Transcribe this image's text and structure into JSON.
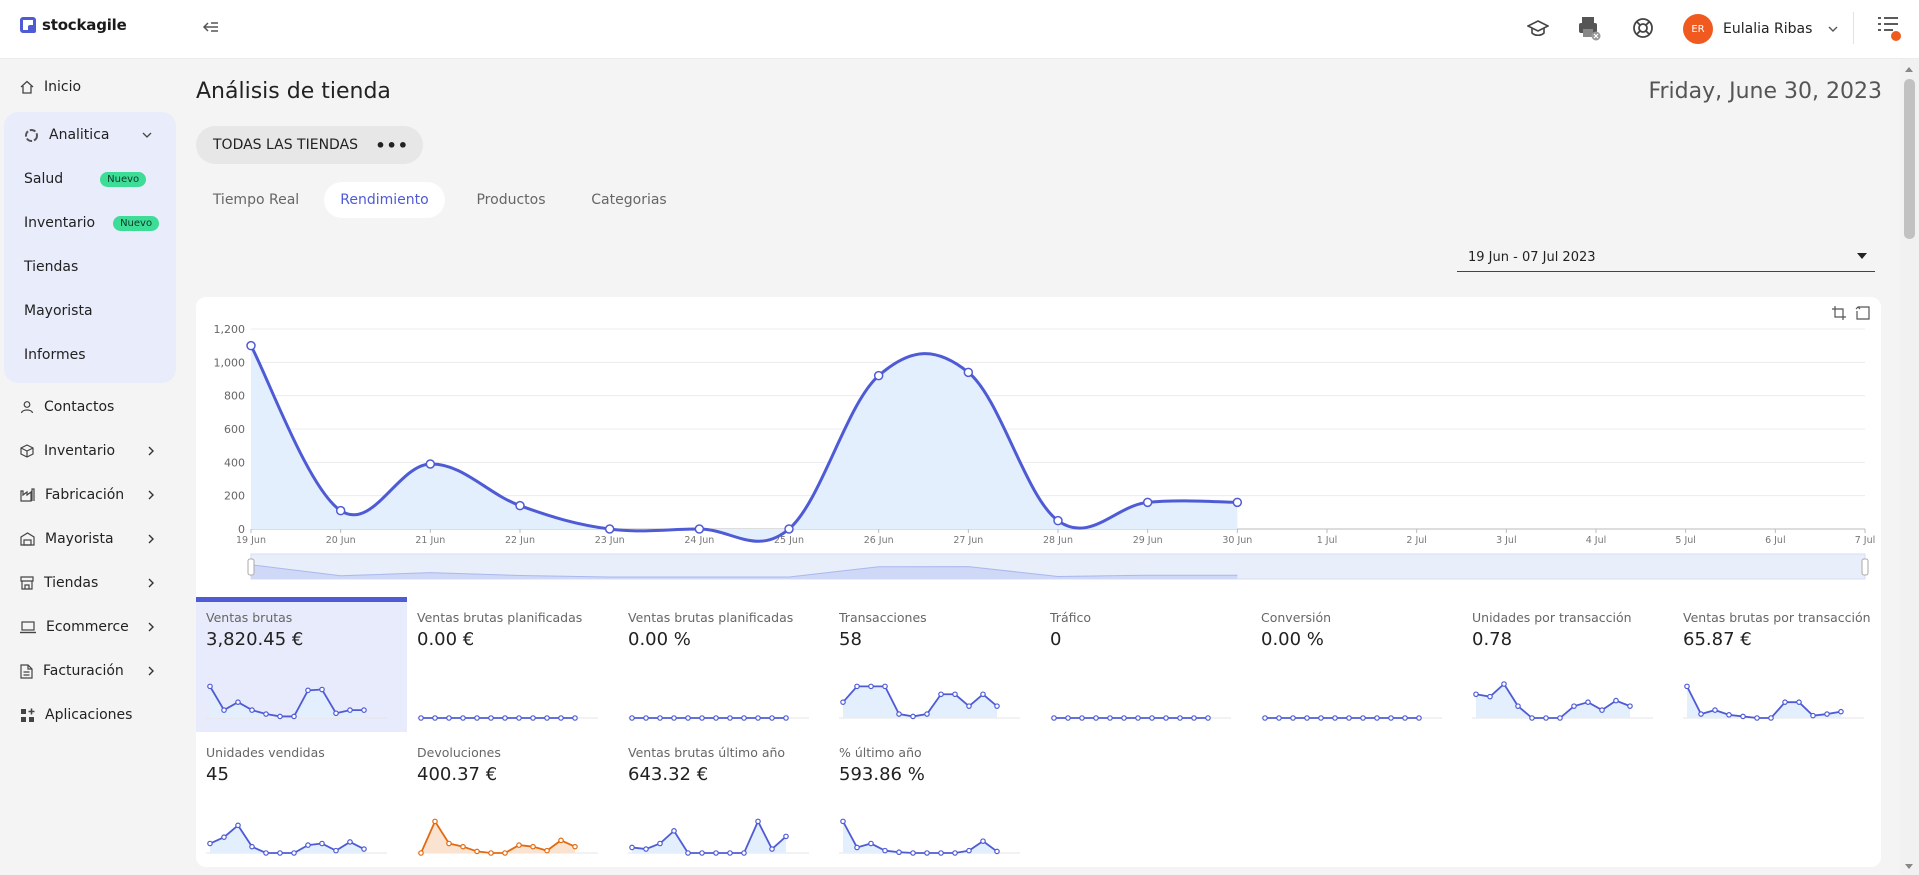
{
  "app": {
    "brand": "stockagile"
  },
  "header": {
    "user_initials": "ER",
    "user_name": "Eulalia Ribas",
    "icons": [
      "graduation-cap-icon",
      "printer-icon",
      "support-icon",
      "menu-list-icon"
    ]
  },
  "sidebar": {
    "home": "Inicio",
    "analytics": {
      "label": "Analitica",
      "items": [
        {
          "label": "Salud",
          "badge": "Nuevo"
        },
        {
          "label": "Inventario",
          "badge": "Nuevo"
        },
        {
          "label": "Tiendas",
          "badge": ""
        },
        {
          "label": "Mayorista",
          "badge": ""
        },
        {
          "label": "Informes",
          "badge": ""
        }
      ]
    },
    "items": [
      {
        "label": "Contactos",
        "icon": "user-icon"
      },
      {
        "label": "Inventario",
        "icon": "box-icon"
      },
      {
        "label": "Fabricación",
        "icon": "factory-icon"
      },
      {
        "label": "Mayorista",
        "icon": "warehouse-icon"
      },
      {
        "label": "Tiendas",
        "icon": "store-icon"
      },
      {
        "label": "Ecommerce",
        "icon": "laptop-icon"
      },
      {
        "label": "Facturación",
        "icon": "invoice-icon"
      },
      {
        "label": "Aplicaciones",
        "icon": "apps-icon"
      }
    ]
  },
  "main": {
    "title": "Análisis de tienda",
    "date": "Friday, June 30, 2023",
    "store_selector": "TODAS LAS TIENDAS",
    "tabs": [
      "Tiempo Real",
      "Rendimiento",
      "Productos",
      "Categorias"
    ],
    "active_tab": "Rendimiento",
    "date_range": "19 Jun - 07 Jul 2023"
  },
  "chart_data": {
    "type": "area",
    "categories": [
      "19 Jun",
      "20 Jun",
      "21 Jun",
      "22 Jun",
      "23 Jun",
      "24 Jun",
      "25 Jun",
      "26 Jun",
      "27 Jun",
      "28 Jun",
      "29 Jun",
      "30 Jun",
      "1 Jul",
      "2 Jul",
      "3 Jul",
      "4 Jul",
      "5 Jul",
      "6 Jul",
      "7 Jul"
    ],
    "values": [
      1100,
      110,
      390,
      140,
      0,
      0,
      0,
      920,
      940,
      50,
      160,
      160,
      null,
      null,
      null,
      null,
      null,
      null,
      null
    ],
    "yticks": [
      0,
      200,
      400,
      600,
      800,
      1000,
      1200
    ],
    "yticks_labels": [
      "0",
      "200",
      "400",
      "600",
      "800",
      "1,000",
      "1,200"
    ],
    "ylim": [
      0,
      1200
    ],
    "color": "#4f5bd5",
    "fill": "#e3effc",
    "grid": true
  },
  "kpis": [
    {
      "label": "Ventas brutas",
      "value": "3,820.45 €",
      "selected": true,
      "color": "#4f5bd5",
      "spark": [
        4,
        1,
        2,
        1,
        0.5,
        0.2,
        0.2,
        3.5,
        3.6,
        0.6,
        1,
        1
      ]
    },
    {
      "label": "Ventas brutas planificadas",
      "value": "0.00 €",
      "selected": false,
      "color": "#4f5bd5",
      "spark": [
        0,
        0,
        0,
        0,
        0,
        0,
        0,
        0,
        0,
        0,
        0,
        0
      ]
    },
    {
      "label": "Ventas brutas planificadas",
      "value": "0.00 %",
      "selected": false,
      "color": "#4f5bd5",
      "spark": [
        0,
        0,
        0,
        0,
        0,
        0,
        0,
        0,
        0,
        0,
        0,
        0
      ]
    },
    {
      "label": "Transacciones",
      "value": "58",
      "selected": false,
      "color": "#4f5bd5",
      "spark": [
        2,
        4,
        4,
        4,
        0.5,
        0.2,
        0.5,
        3,
        3,
        1.5,
        3,
        1.5
      ]
    },
    {
      "label": "Tráfico",
      "value": "0",
      "selected": false,
      "color": "#4f5bd5",
      "spark": [
        0,
        0,
        0,
        0,
        0,
        0,
        0,
        0,
        0,
        0,
        0,
        0
      ]
    },
    {
      "label": "Conversión",
      "value": "0.00 %",
      "selected": false,
      "color": "#4f5bd5",
      "spark": [
        0,
        0,
        0,
        0,
        0,
        0,
        0,
        0,
        0,
        0,
        0,
        0
      ]
    },
    {
      "label": "Unidades por transacción",
      "value": "0.78",
      "selected": false,
      "color": "#4f5bd5",
      "spark": [
        3,
        2.7,
        4.3,
        1.5,
        0,
        0,
        0,
        1.5,
        2,
        1,
        2.2,
        1.5
      ]
    },
    {
      "label": "Ventas brutas por transacción",
      "value": "65.87 €",
      "selected": false,
      "color": "#4f5bd5",
      "spark": [
        4,
        0.5,
        1,
        0.4,
        0.2,
        0,
        0,
        2,
        2,
        0.3,
        0.5,
        0.8
      ]
    },
    {
      "label": "Unidades vendidas",
      "value": "45",
      "selected": false,
      "color": "#4f5bd5",
      "spark": [
        1.2,
        2,
        3.5,
        0.8,
        0,
        0,
        0,
        1,
        1.2,
        0.3,
        1.4,
        0.5
      ]
    },
    {
      "label": "Devoluciones",
      "value": "400.37 €",
      "selected": false,
      "color": "#e36a10",
      "spark": [
        0,
        4,
        1.2,
        0.8,
        0.2,
        0,
        0,
        1,
        0.8,
        0.3,
        1.6,
        0.8
      ]
    },
    {
      "label": "Ventas brutas último año",
      "value": "643.32 €",
      "selected": false,
      "color": "#4f5bd5",
      "spark": [
        0.7,
        0.5,
        1.2,
        2.8,
        0,
        0,
        0,
        0,
        0,
        4,
        0.5,
        2.1
      ]
    },
    {
      "label": "% último año",
      "value": "593.86 %",
      "selected": false,
      "color": "#4f5bd5",
      "spark": [
        4,
        0.7,
        1.2,
        0.3,
        0.1,
        0,
        0,
        0,
        0,
        0.3,
        1.5,
        0.2
      ]
    }
  ]
}
